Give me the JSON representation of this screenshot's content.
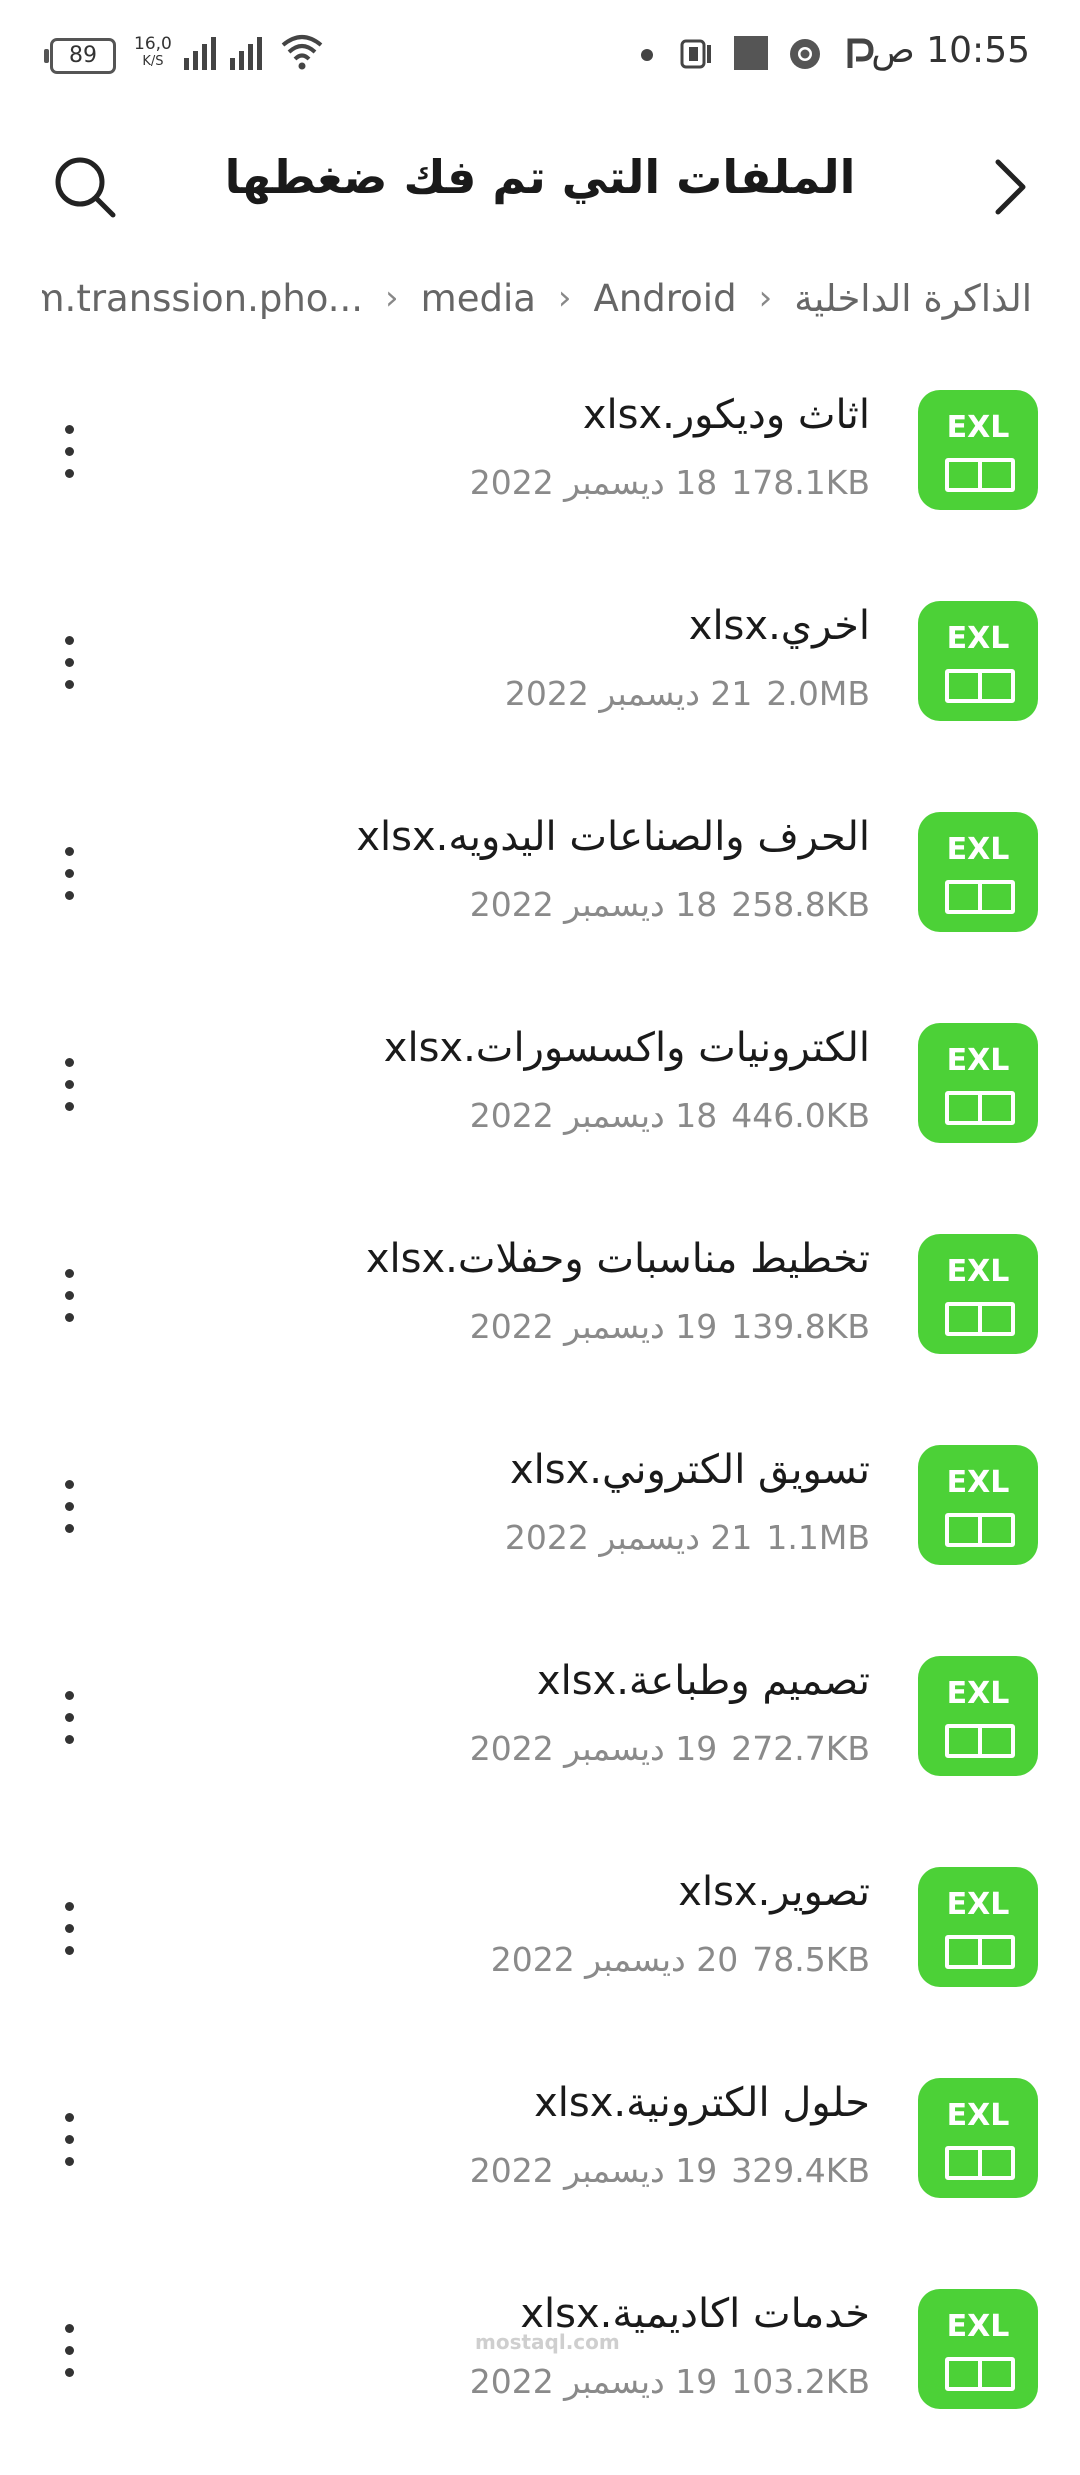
{
  "status_bar": {
    "time": "10:55 ص",
    "battery": "89",
    "net_speed_value": "16,0",
    "net_speed_unit": "K/S",
    "icons": [
      "battery-icon",
      "signal-icon",
      "signal-icon",
      "wifi-icon",
      "notification-dot-icon",
      "app-icon",
      "square-icon",
      "chrome-icon",
      "p-app-icon"
    ]
  },
  "header": {
    "title": "الملفات التي تم فك ضغطها",
    "back_icon": "chevron-back-icon",
    "search_icon": "search-icon"
  },
  "breadcrumb": [
    "الذاكرة الداخلية",
    "Android",
    "media",
    "com.transsion.pho..."
  ],
  "files": [
    {
      "name": "اثاث وديكور.xlsx",
      "date": "18 ديسمبر 2022",
      "size": "178.1KB",
      "icon": "EXL"
    },
    {
      "name": "اخري.xlsx",
      "date": "21 ديسمبر 2022",
      "size": "2.0MB",
      "icon": "EXL"
    },
    {
      "name": "الحرف والصناعات اليدويه.xlsx",
      "date": "18 ديسمبر 2022",
      "size": "258.8KB",
      "icon": "EXL"
    },
    {
      "name": "الكترونيات واكسسورات.xlsx",
      "date": "18 ديسمبر 2022",
      "size": "446.0KB",
      "icon": "EXL"
    },
    {
      "name": "تخطيط مناسبات وحفلات.xlsx",
      "date": "19 ديسمبر 2022",
      "size": "139.8KB",
      "icon": "EXL"
    },
    {
      "name": "تسويق الكتروني.xlsx",
      "date": "21 ديسمبر 2022",
      "size": "1.1MB",
      "icon": "EXL"
    },
    {
      "name": "تصميم وطباعة.xlsx",
      "date": "19 ديسمبر 2022",
      "size": "272.7KB",
      "icon": "EXL"
    },
    {
      "name": "تصوير.xlsx",
      "date": "20 ديسمبر 2022",
      "size": "78.5KB",
      "icon": "EXL"
    },
    {
      "name": "حلول الكترونية.xlsx",
      "date": "19 ديسمبر 2022",
      "size": "329.4KB",
      "icon": "EXL"
    },
    {
      "name": "خدمات اكاديمية.xlsx",
      "date": "19 ديسمبر 2022",
      "size": "103.2KB",
      "icon": "EXL"
    }
  ],
  "watermark": "mostaql.com",
  "colors": {
    "icon_green": "#4cd137"
  }
}
